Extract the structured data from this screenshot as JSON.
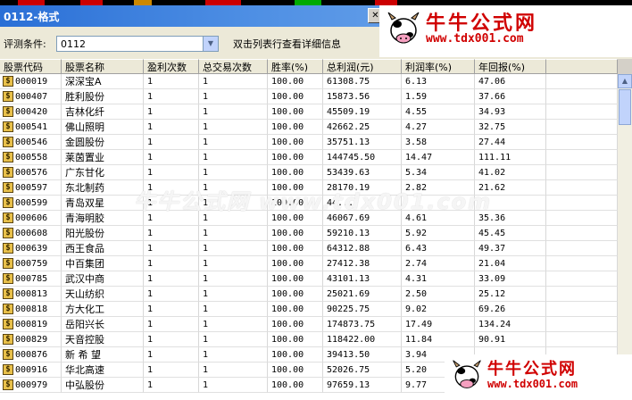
{
  "window": {
    "title": "0112-格式"
  },
  "filter": {
    "label": "评测条件:",
    "value": "0112",
    "hint": "双击列表行查看详细信息"
  },
  "columns": [
    "股票代码",
    "股票名称",
    "盈利次数",
    "总交易次数",
    "胜率(%)",
    "总利润(元)",
    "利润率(%)",
    "年回报(%)"
  ],
  "rows": [
    {
      "code": "000019",
      "name": "深深宝A",
      "wins": "1",
      "trades": "1",
      "rate": "100.00",
      "profit": "61308.75",
      "margin": "6.13",
      "annual": "47.06"
    },
    {
      "code": "000407",
      "name": "胜利股份",
      "wins": "1",
      "trades": "1",
      "rate": "100.00",
      "profit": "15873.56",
      "margin": "1.59",
      "annual": "37.66"
    },
    {
      "code": "000420",
      "name": "吉林化纤",
      "wins": "1",
      "trades": "1",
      "rate": "100.00",
      "profit": "45509.19",
      "margin": "4.55",
      "annual": "34.93"
    },
    {
      "code": "000541",
      "name": "佛山照明",
      "wins": "1",
      "trades": "1",
      "rate": "100.00",
      "profit": "42662.25",
      "margin": "4.27",
      "annual": "32.75"
    },
    {
      "code": "000546",
      "name": "金圆股份",
      "wins": "1",
      "trades": "1",
      "rate": "100.00",
      "profit": "35751.13",
      "margin": "3.58",
      "annual": "27.44"
    },
    {
      "code": "000558",
      "name": "莱茵置业",
      "wins": "1",
      "trades": "1",
      "rate": "100.00",
      "profit": "144745.50",
      "margin": "14.47",
      "annual": "111.11"
    },
    {
      "code": "000576",
      "name": "广东甘化",
      "wins": "1",
      "trades": "1",
      "rate": "100.00",
      "profit": "53439.63",
      "margin": "5.34",
      "annual": "41.02"
    },
    {
      "code": "000597",
      "name": "东北制药",
      "wins": "1",
      "trades": "1",
      "rate": "100.00",
      "profit": "28170.19",
      "margin": "2.82",
      "annual": "21.62"
    },
    {
      "code": "000599",
      "name": "青岛双星",
      "wins": "1",
      "trades": "1",
      "rate": "100.00",
      "profit": "44...",
      "margin": "",
      "annual": ""
    },
    {
      "code": "000606",
      "name": "青海明胶",
      "wins": "1",
      "trades": "1",
      "rate": "100.00",
      "profit": "46067.69",
      "margin": "4.61",
      "annual": "35.36"
    },
    {
      "code": "000608",
      "name": "阳光股份",
      "wins": "1",
      "trades": "1",
      "rate": "100.00",
      "profit": "59210.13",
      "margin": "5.92",
      "annual": "45.45"
    },
    {
      "code": "000639",
      "name": "西王食品",
      "wins": "1",
      "trades": "1",
      "rate": "100.00",
      "profit": "64312.88",
      "margin": "6.43",
      "annual": "49.37"
    },
    {
      "code": "000759",
      "name": "中百集团",
      "wins": "1",
      "trades": "1",
      "rate": "100.00",
      "profit": "27412.38",
      "margin": "2.74",
      "annual": "21.04"
    },
    {
      "code": "000785",
      "name": "武汉中商",
      "wins": "1",
      "trades": "1",
      "rate": "100.00",
      "profit": "43101.13",
      "margin": "4.31",
      "annual": "33.09"
    },
    {
      "code": "000813",
      "name": "天山纺织",
      "wins": "1",
      "trades": "1",
      "rate": "100.00",
      "profit": "25021.69",
      "margin": "2.50",
      "annual": "25.12"
    },
    {
      "code": "000818",
      "name": "方大化工",
      "wins": "1",
      "trades": "1",
      "rate": "100.00",
      "profit": "90225.75",
      "margin": "9.02",
      "annual": "69.26"
    },
    {
      "code": "000819",
      "name": "岳阳兴长",
      "wins": "1",
      "trades": "1",
      "rate": "100.00",
      "profit": "174873.75",
      "margin": "17.49",
      "annual": "134.24"
    },
    {
      "code": "000829",
      "name": "天音控股",
      "wins": "1",
      "trades": "1",
      "rate": "100.00",
      "profit": "118422.00",
      "margin": "11.84",
      "annual": "90.91"
    },
    {
      "code": "000876",
      "name": "新 希 望",
      "wins": "1",
      "trades": "1",
      "rate": "100.00",
      "profit": "39413.50",
      "margin": "3.94",
      "annual": ""
    },
    {
      "code": "000916",
      "name": "华北高速",
      "wins": "1",
      "trades": "1",
      "rate": "100.00",
      "profit": "52026.75",
      "margin": "5.20",
      "annual": ""
    },
    {
      "code": "000979",
      "name": "中弘股份",
      "wins": "1",
      "trades": "1",
      "rate": "100.00",
      "profit": "97659.13",
      "margin": "9.77",
      "annual": ""
    }
  ],
  "logo": {
    "brand": "牛牛公式网",
    "url": "www.tdx001.com"
  },
  "watermark": {
    "brand": "牛牛公式网",
    "url": "www.tdx001.com"
  },
  "colors": {
    "title_bar": "#2a6fd6",
    "brand_red": "#d00000",
    "grid_bg": "#ffffff",
    "window_bg": "#d4d0c8"
  }
}
